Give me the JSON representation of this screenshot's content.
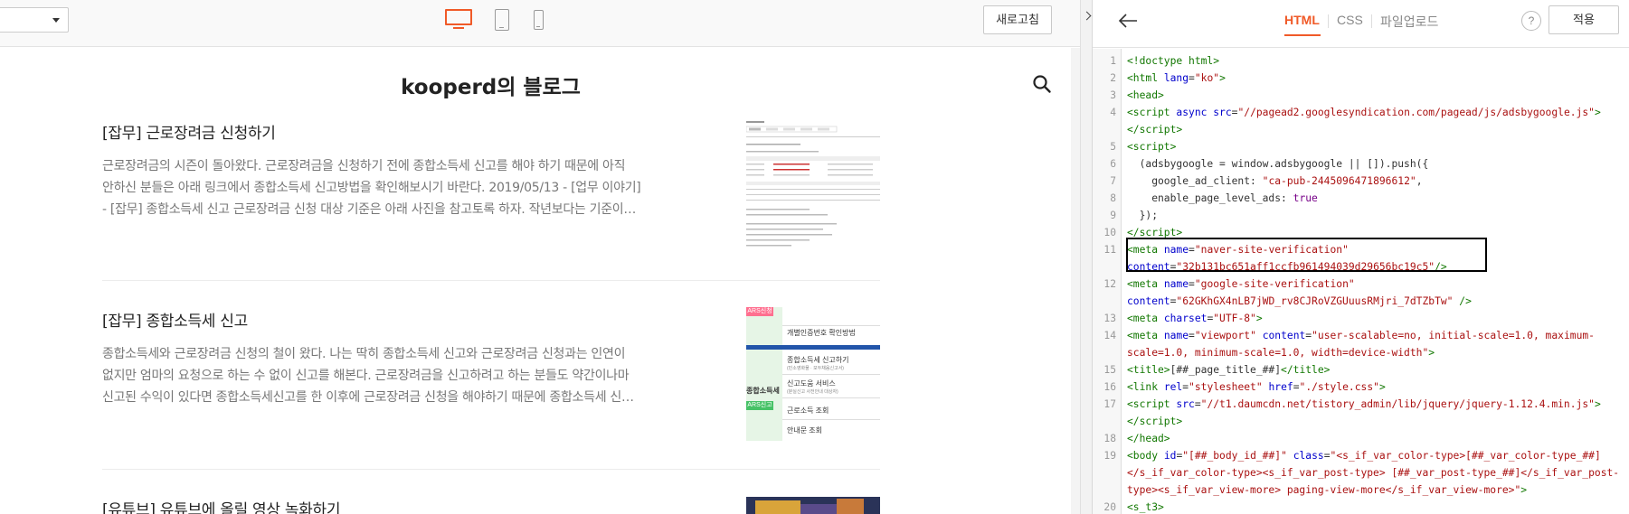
{
  "toolbar": {
    "refresh_label": "새로고침",
    "devices": [
      "desktop-icon",
      "tablet-icon",
      "phone-icon"
    ],
    "active_device": "desktop",
    "accent": "#f05a28"
  },
  "blog": {
    "title": "kooperd의 블로그",
    "posts": [
      {
        "title": "[잡무] 근로장려금 신청하기",
        "lines": [
          "근로장려금의 시즌이 돌아왔다. 근로장려금을 신청하기 전에 종합소득세 신고를 해야 하기 때문에 아직",
          "안하신 분들은 아래 링크에서 종합소득세 신고방법을 확인해보시기 바란다. 2019/05/13 - [업무 이야기]",
          "- [잡무] 종합소득세 신고 근로장려금 신청 대상 기준은 아래 사진을 참고토록 하자. 작년보다는 기준이…"
        ]
      },
      {
        "title": "[잡무] 종합소득세 신고",
        "lines": [
          "종합소득세와 근로장려금 신청의 철이 왔다. 나는 딱히 종합소득세 신고와 근로장려금 신청과는 인연이",
          "없지만 엄마의 요청으로 하는 수 없이 신고를 해본다. 근로장려금을 신고하려고 하는 분들도 약간이나마",
          "신고된 수익이 있다면 종합소득세신고를 한 이후에 근로장려금 신청을 해야하기 때문에 종합소득세 신…"
        ],
        "thumb": {
          "tags": [
            "ARS신청",
            "ARS신고"
          ],
          "items": [
            "개별인증번호 확인방법",
            "종합소득세 신고하기",
            "(민소영화물 · 모두채움신고서)",
            "신고도움 서비스",
            "(분실신고 사전안내 대상자)",
            "근로소득 조회",
            "안내문 조회",
            "종합소득세"
          ]
        }
      },
      {
        "title": "[유튜브] 유튜브에 올릴 영상 녹화하기",
        "lines": []
      }
    ]
  },
  "editor": {
    "tabs": [
      "HTML",
      "CSS",
      "파일업로드"
    ],
    "active_tab": "HTML",
    "help": "?",
    "apply_label": "적용"
  }
}
